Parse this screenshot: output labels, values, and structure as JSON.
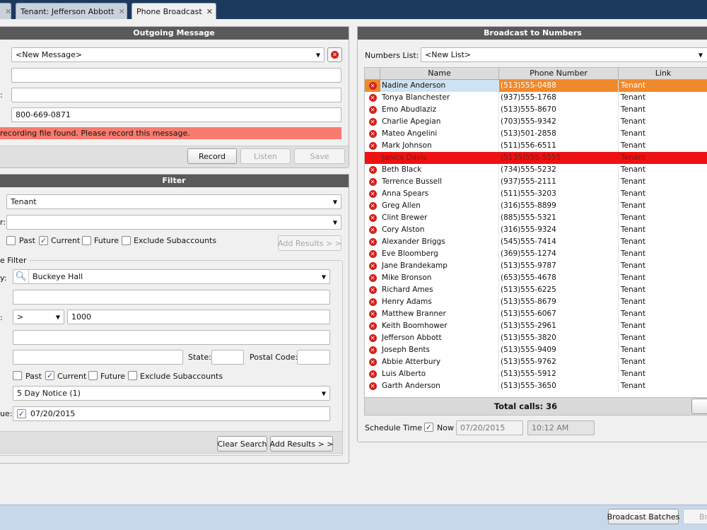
{
  "tabs": [
    {
      "label": "Tenant: Jefferson Abbott"
    },
    {
      "label": "Phone Broadcast"
    }
  ],
  "outgoing": {
    "header": "Outgoing Message",
    "message_select": "<New Message>",
    "field2": "",
    "field3": "",
    "caller_id": "800-669-0871",
    "warning": "recording file found. Please record this message.",
    "record_label": "Record",
    "listen_label": "Listen",
    "save_label": "Save"
  },
  "filter": {
    "header": "Filter",
    "type_value": "Tenant",
    "second_value": "",
    "past_label": "Past",
    "current_label": "Current",
    "future_label": "Future",
    "exclude_label": "Exclude Subaccounts",
    "add_results_label": "Add Results > >",
    "section_title": "e Filter",
    "property_label_frag": "y:",
    "property_value": "Buckeye Hall",
    "op_value": ">",
    "amount_value": "1000",
    "state_label": "State:",
    "postal_label": "Postal Code:",
    "past2_label": "Past",
    "current2_label": "Current",
    "future2_label": "Future",
    "exclude2_label": "Exclude Subaccounts",
    "notice_value": "5 Day Notice (1)",
    "due_label_frag": "ue:",
    "due_date": "07/20/2015",
    "clear_label": "Clear Search",
    "add_results2_label": "Add Results > >"
  },
  "broadcast": {
    "header": "Broadcast to Numbers",
    "numbers_list_label": "Numbers List:",
    "numbers_list_value": "<New List>",
    "columns": [
      "Name",
      "Phone Number",
      "Link"
    ],
    "rows": [
      {
        "name": "Nadine Anderson",
        "phone": "(513)555-0488",
        "link": "Tenant",
        "state": "selected"
      },
      {
        "name": "Tonya Blanchester",
        "phone": "(937)555-1768",
        "link": "Tenant",
        "state": ""
      },
      {
        "name": "Emo Abudlaziz",
        "phone": "(513)555-8670",
        "link": "Tenant",
        "state": ""
      },
      {
        "name": "Charlie Apegian",
        "phone": "(703)555-9342",
        "link": "Tenant",
        "state": ""
      },
      {
        "name": "Mateo Angelini",
        "phone": "(513)501-2858",
        "link": "Tenant",
        "state": ""
      },
      {
        "name": "Mark Johnson",
        "phone": "(511)556-6511",
        "link": "Tenant",
        "state": ""
      },
      {
        "name": "Janica Davis",
        "phone": "(5135)555-5555",
        "link": "Tenant",
        "state": "error"
      },
      {
        "name": "Beth Black",
        "phone": "(734)555-5232",
        "link": "Tenant",
        "state": ""
      },
      {
        "name": "Terrence Bussell",
        "phone": "(937)555-2111",
        "link": "Tenant",
        "state": ""
      },
      {
        "name": "Anna Spears",
        "phone": "(511)555-3203",
        "link": "Tenant",
        "state": ""
      },
      {
        "name": "Greg Allen",
        "phone": "(316)555-8899",
        "link": "Tenant",
        "state": ""
      },
      {
        "name": "Clint Brewer",
        "phone": "(885)555-5321",
        "link": "Tenant",
        "state": ""
      },
      {
        "name": "Cory Alston",
        "phone": "(316)555-9324",
        "link": "Tenant",
        "state": ""
      },
      {
        "name": "Alexander Briggs",
        "phone": "(545)555-7414",
        "link": "Tenant",
        "state": ""
      },
      {
        "name": "Eve Bloomberg",
        "phone": "(369)555-1274",
        "link": "Tenant",
        "state": ""
      },
      {
        "name": "Jane Brandekamp",
        "phone": "(513)555-9787",
        "link": "Tenant",
        "state": ""
      },
      {
        "name": "Mike Bronson",
        "phone": "(653)555-4678",
        "link": "Tenant",
        "state": ""
      },
      {
        "name": "Richard Ames",
        "phone": "(513)555-6225",
        "link": "Tenant",
        "state": ""
      },
      {
        "name": "Henry Adams",
        "phone": "(513)555-8679",
        "link": "Tenant",
        "state": ""
      },
      {
        "name": "Matthew Branner",
        "phone": "(513)555-6067",
        "link": "Tenant",
        "state": ""
      },
      {
        "name": "Keith Boomhower",
        "phone": "(513)555-2961",
        "link": "Tenant",
        "state": ""
      },
      {
        "name": "Jefferson Abbott",
        "phone": "(513)555-3820",
        "link": "Tenant",
        "state": ""
      },
      {
        "name": "Joseph Bents",
        "phone": "(513)555-9409",
        "link": "Tenant",
        "state": ""
      },
      {
        "name": "Abbie Atterbury",
        "phone": "(513)555-9762",
        "link": "Tenant",
        "state": ""
      },
      {
        "name": "Luis Alberto",
        "phone": "(513)555-5912",
        "link": "Tenant",
        "state": ""
      },
      {
        "name": "Garth Anderson",
        "phone": "(513)555-3650",
        "link": "Tenant",
        "state": ""
      }
    ],
    "total_calls": "Total calls: 36",
    "schedule_label": "Schedule Time :",
    "now_label": "Now",
    "schedule_date": "07/20/2015",
    "schedule_time": "10:12 AM"
  },
  "bottom": {
    "broadcast_batches_label": "Broadcast Batches",
    "next_btn_frag": "Br"
  },
  "colors": {
    "selected_row": "#f0892c",
    "error_row": "#ee1111",
    "warning_bar": "#f77b6f",
    "header_bar": "#5a5a5a",
    "tabbar": "#1c3a5e"
  }
}
